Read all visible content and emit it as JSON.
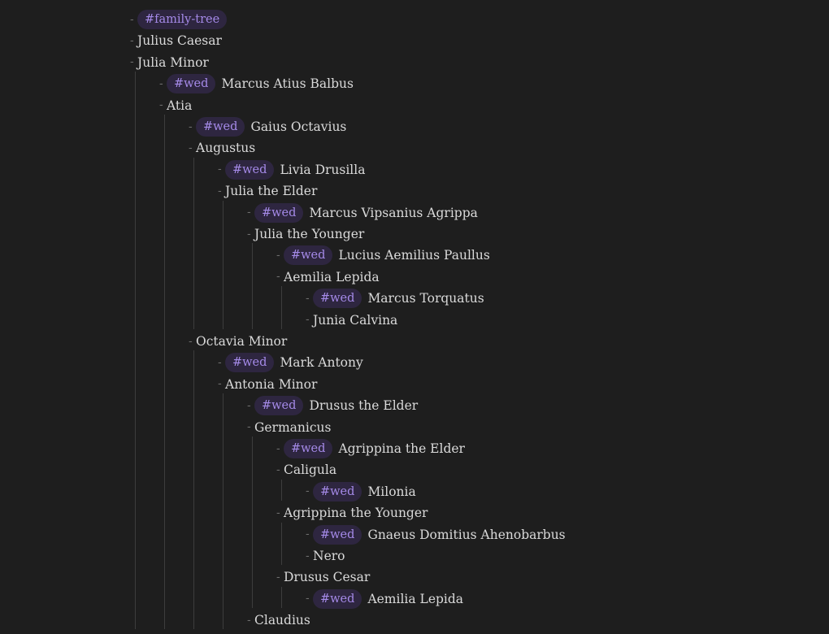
{
  "outline": {
    "rows": [
      {
        "depth": 0,
        "tag": "#family-tree",
        "text": ""
      },
      {
        "depth": 0,
        "tag": "",
        "text": "Julius Caesar"
      },
      {
        "depth": 0,
        "tag": "",
        "text": "Julia Minor"
      },
      {
        "depth": 1,
        "tag": "#wed",
        "text": "Marcus Atius Balbus"
      },
      {
        "depth": 1,
        "tag": "",
        "text": "Atia"
      },
      {
        "depth": 2,
        "tag": "#wed",
        "text": "Gaius Octavius"
      },
      {
        "depth": 2,
        "tag": "",
        "text": "Augustus"
      },
      {
        "depth": 3,
        "tag": "#wed",
        "text": "Livia Drusilla"
      },
      {
        "depth": 3,
        "tag": "",
        "text": "Julia the Elder"
      },
      {
        "depth": 4,
        "tag": "#wed",
        "text": "Marcus Vipsanius Agrippa"
      },
      {
        "depth": 4,
        "tag": "",
        "text": "Julia the Younger"
      },
      {
        "depth": 5,
        "tag": "#wed",
        "text": "Lucius Aemilius Paullus"
      },
      {
        "depth": 5,
        "tag": "",
        "text": "Aemilia Lepida"
      },
      {
        "depth": 6,
        "tag": "#wed",
        "text": "Marcus Torquatus"
      },
      {
        "depth": 6,
        "tag": "",
        "text": "Junia Calvina"
      },
      {
        "depth": 2,
        "tag": "",
        "text": "Octavia Minor"
      },
      {
        "depth": 3,
        "tag": "#wed",
        "text": "Mark Antony"
      },
      {
        "depth": 3,
        "tag": "",
        "text": "Antonia Minor"
      },
      {
        "depth": 4,
        "tag": "#wed",
        "text": "Drusus the Elder"
      },
      {
        "depth": 4,
        "tag": "",
        "text": "Germanicus"
      },
      {
        "depth": 5,
        "tag": "#wed",
        "text": "Agrippina the Elder"
      },
      {
        "depth": 5,
        "tag": "",
        "text": "Caligula"
      },
      {
        "depth": 6,
        "tag": "#wed",
        "text": "Milonia"
      },
      {
        "depth": 5,
        "tag": "",
        "text": "Agrippina the Younger"
      },
      {
        "depth": 6,
        "tag": "#wed",
        "text": "Gnaeus Domitius Ahenobarbus"
      },
      {
        "depth": 6,
        "tag": "",
        "text": "Nero"
      },
      {
        "depth": 5,
        "tag": "",
        "text": "Drusus Cesar"
      },
      {
        "depth": 6,
        "tag": "#wed",
        "text": "Aemilia Lepida"
      },
      {
        "depth": 4,
        "tag": "",
        "text": "Claudius"
      }
    ]
  }
}
